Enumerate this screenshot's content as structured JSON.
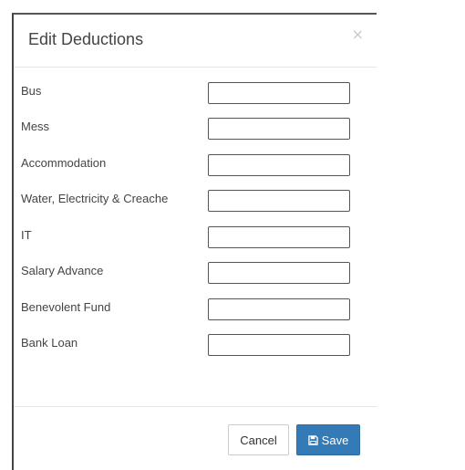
{
  "dialog": {
    "title": "Edit Deductions",
    "close_symbol": "×"
  },
  "fields": [
    {
      "label": "Bus",
      "value": ""
    },
    {
      "label": "Mess",
      "value": ""
    },
    {
      "label": "Accommodation",
      "value": ""
    },
    {
      "label": "Water, Electricity & Creache",
      "value": ""
    },
    {
      "label": "IT",
      "value": ""
    },
    {
      "label": "Salary Advance",
      "value": ""
    },
    {
      "label": "Benevolent Fund",
      "value": ""
    },
    {
      "label": "Bank Loan",
      "value": ""
    }
  ],
  "footer": {
    "cancel_label": "Cancel",
    "save_label": "Save",
    "save_icon": "floppy-disk-icon"
  },
  "colors": {
    "primary": "#337ab7",
    "border": "#555555",
    "divider": "#e5e5e5"
  }
}
